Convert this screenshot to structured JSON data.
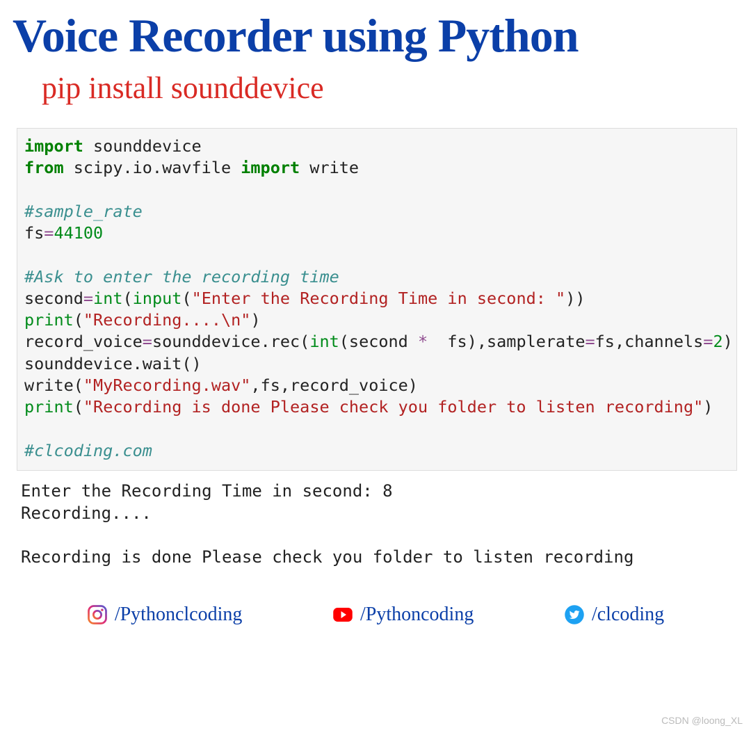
{
  "title": "Voice Recorder using Python",
  "subtitle": "pip install sounddevice",
  "code": {
    "l1_kw1": "import",
    "l1_rest": " sounddevice",
    "l2_kw1": "from",
    "l2_mid": " scipy.io.wavfile ",
    "l2_kw2": "import",
    "l2_rest": " write",
    "cm1": "#sample_rate",
    "fs_lhs": "fs",
    "fs_eq": "=",
    "fs_val": "44100",
    "cm2": "#Ask to enter the recording time",
    "sec_lhs": "second",
    "eq": "=",
    "int_": "int",
    "input_": "input",
    "str_prompt": "\"Enter the Recording Time in second: \"",
    "print_": "print",
    "str_recording": "\"Recording....\\n\"",
    "rv_lhs": "record_voice",
    "rv_call": "sounddevice.rec(",
    "star": " * ",
    "rv_mid": " fs),samplerate",
    "rv_mid2": "fs,channels",
    "two": "2",
    "wait_line": "sounddevice.wait()",
    "write_pre": "write(",
    "str_file": "\"MyRecording.wav\"",
    "write_post": ",fs,record_voice)",
    "str_done": "\"Recording is done Please check you folder to listen recording\"",
    "cm3": "#clcoding.com",
    "second_word": "second"
  },
  "output": "Enter the Recording Time in second: 8\nRecording....\n\nRecording is done Please check you folder to listen recording",
  "socials": {
    "instagram": "/Pythonclcoding",
    "youtube": "/Pythoncoding",
    "twitter": "/clcoding"
  },
  "watermark": "CSDN @loong_XL"
}
